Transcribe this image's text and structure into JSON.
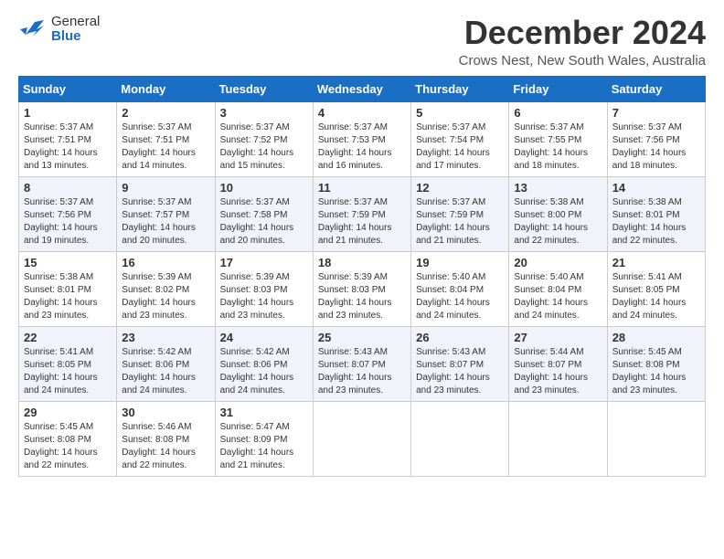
{
  "logo": {
    "general": "General",
    "blue": "Blue"
  },
  "title": "December 2024",
  "subtitle": "Crows Nest, New South Wales, Australia",
  "days_header": [
    "Sunday",
    "Monday",
    "Tuesday",
    "Wednesday",
    "Thursday",
    "Friday",
    "Saturday"
  ],
  "weeks": [
    [
      {
        "day": 1,
        "info": "Sunrise: 5:37 AM\nSunset: 7:51 PM\nDaylight: 14 hours\nand 13 minutes."
      },
      {
        "day": 2,
        "info": "Sunrise: 5:37 AM\nSunset: 7:51 PM\nDaylight: 14 hours\nand 14 minutes."
      },
      {
        "day": 3,
        "info": "Sunrise: 5:37 AM\nSunset: 7:52 PM\nDaylight: 14 hours\nand 15 minutes."
      },
      {
        "day": 4,
        "info": "Sunrise: 5:37 AM\nSunset: 7:53 PM\nDaylight: 14 hours\nand 16 minutes."
      },
      {
        "day": 5,
        "info": "Sunrise: 5:37 AM\nSunset: 7:54 PM\nDaylight: 14 hours\nand 17 minutes."
      },
      {
        "day": 6,
        "info": "Sunrise: 5:37 AM\nSunset: 7:55 PM\nDaylight: 14 hours\nand 18 minutes."
      },
      {
        "day": 7,
        "info": "Sunrise: 5:37 AM\nSunset: 7:56 PM\nDaylight: 14 hours\nand 18 minutes."
      }
    ],
    [
      {
        "day": 8,
        "info": "Sunrise: 5:37 AM\nSunset: 7:56 PM\nDaylight: 14 hours\nand 19 minutes."
      },
      {
        "day": 9,
        "info": "Sunrise: 5:37 AM\nSunset: 7:57 PM\nDaylight: 14 hours\nand 20 minutes."
      },
      {
        "day": 10,
        "info": "Sunrise: 5:37 AM\nSunset: 7:58 PM\nDaylight: 14 hours\nand 20 minutes."
      },
      {
        "day": 11,
        "info": "Sunrise: 5:37 AM\nSunset: 7:59 PM\nDaylight: 14 hours\nand 21 minutes."
      },
      {
        "day": 12,
        "info": "Sunrise: 5:37 AM\nSunset: 7:59 PM\nDaylight: 14 hours\nand 21 minutes."
      },
      {
        "day": 13,
        "info": "Sunrise: 5:38 AM\nSunset: 8:00 PM\nDaylight: 14 hours\nand 22 minutes."
      },
      {
        "day": 14,
        "info": "Sunrise: 5:38 AM\nSunset: 8:01 PM\nDaylight: 14 hours\nand 22 minutes."
      }
    ],
    [
      {
        "day": 15,
        "info": "Sunrise: 5:38 AM\nSunset: 8:01 PM\nDaylight: 14 hours\nand 23 minutes."
      },
      {
        "day": 16,
        "info": "Sunrise: 5:39 AM\nSunset: 8:02 PM\nDaylight: 14 hours\nand 23 minutes."
      },
      {
        "day": 17,
        "info": "Sunrise: 5:39 AM\nSunset: 8:03 PM\nDaylight: 14 hours\nand 23 minutes."
      },
      {
        "day": 18,
        "info": "Sunrise: 5:39 AM\nSunset: 8:03 PM\nDaylight: 14 hours\nand 23 minutes."
      },
      {
        "day": 19,
        "info": "Sunrise: 5:40 AM\nSunset: 8:04 PM\nDaylight: 14 hours\nand 24 minutes."
      },
      {
        "day": 20,
        "info": "Sunrise: 5:40 AM\nSunset: 8:04 PM\nDaylight: 14 hours\nand 24 minutes."
      },
      {
        "day": 21,
        "info": "Sunrise: 5:41 AM\nSunset: 8:05 PM\nDaylight: 14 hours\nand 24 minutes."
      }
    ],
    [
      {
        "day": 22,
        "info": "Sunrise: 5:41 AM\nSunset: 8:05 PM\nDaylight: 14 hours\nand 24 minutes."
      },
      {
        "day": 23,
        "info": "Sunrise: 5:42 AM\nSunset: 8:06 PM\nDaylight: 14 hours\nand 24 minutes."
      },
      {
        "day": 24,
        "info": "Sunrise: 5:42 AM\nSunset: 8:06 PM\nDaylight: 14 hours\nand 24 minutes."
      },
      {
        "day": 25,
        "info": "Sunrise: 5:43 AM\nSunset: 8:07 PM\nDaylight: 14 hours\nand 23 minutes."
      },
      {
        "day": 26,
        "info": "Sunrise: 5:43 AM\nSunset: 8:07 PM\nDaylight: 14 hours\nand 23 minutes."
      },
      {
        "day": 27,
        "info": "Sunrise: 5:44 AM\nSunset: 8:07 PM\nDaylight: 14 hours\nand 23 minutes."
      },
      {
        "day": 28,
        "info": "Sunrise: 5:45 AM\nSunset: 8:08 PM\nDaylight: 14 hours\nand 23 minutes."
      }
    ],
    [
      {
        "day": 29,
        "info": "Sunrise: 5:45 AM\nSunset: 8:08 PM\nDaylight: 14 hours\nand 22 minutes."
      },
      {
        "day": 30,
        "info": "Sunrise: 5:46 AM\nSunset: 8:08 PM\nDaylight: 14 hours\nand 22 minutes."
      },
      {
        "day": 31,
        "info": "Sunrise: 5:47 AM\nSunset: 8:09 PM\nDaylight: 14 hours\nand 21 minutes."
      },
      null,
      null,
      null,
      null
    ]
  ]
}
